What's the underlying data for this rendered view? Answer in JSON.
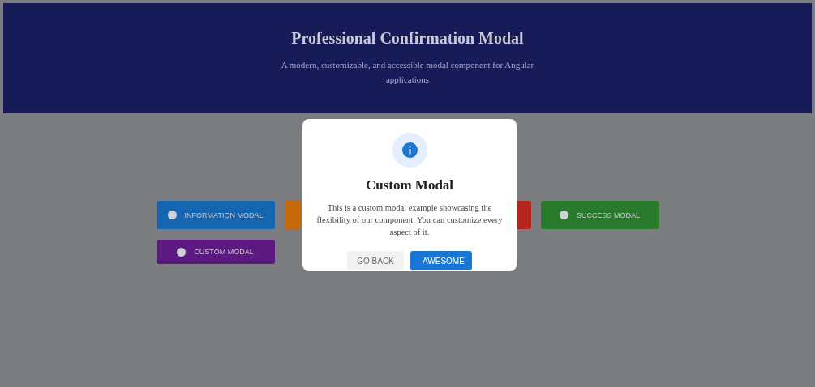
{
  "header": {
    "title": "Professional Confirmation Modal",
    "subtitle": "A modern, customizable, and accessible modal component for Angular applications"
  },
  "demo_buttons": [
    {
      "label": "INFORMATION MODAL",
      "color": "#1565b0"
    },
    {
      "color": "#c46a0a"
    },
    {
      "color": "#b3261e"
    },
    {
      "label": "SUCCESS MODAL",
      "color": "#2a7a2e"
    },
    {
      "label": "CUSTOM MODAL",
      "color": "#5c1a80"
    }
  ],
  "modal": {
    "title": "Custom Modal",
    "message": "This is a custom modal example showcasing the flexibility of our component. You can customize every aspect of it.",
    "buttons": [
      {
        "label": "GO BACK",
        "kind": "secondary"
      },
      {
        "label": "AWESOME",
        "kind": "primary"
      }
    ]
  }
}
